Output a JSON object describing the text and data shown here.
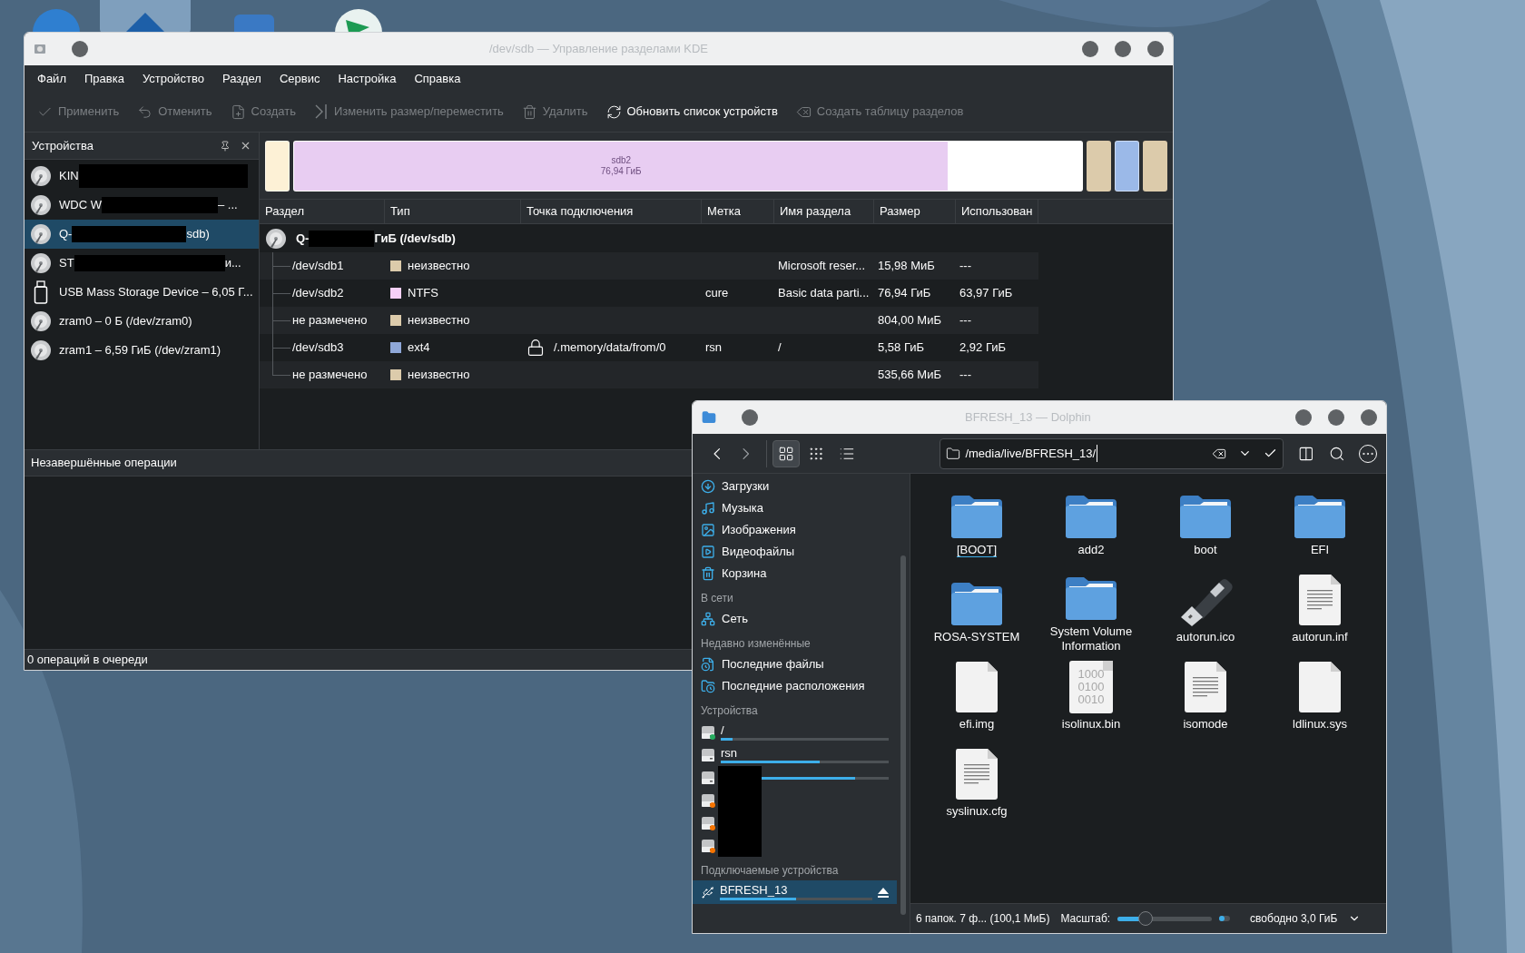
{
  "desktop_icons": [
    {
      "kind": "globe",
      "selected": false
    },
    {
      "kind": "home",
      "selected": true
    },
    {
      "kind": "window",
      "selected": false
    },
    {
      "kind": "arrow",
      "selected": false
    }
  ],
  "partition_manager": {
    "window_title": "/dev/sdb — Управление разделами KDE",
    "menu": [
      "Файл",
      "Правка",
      "Устройство",
      "Раздел",
      "Сервис",
      "Настройка",
      "Справка"
    ],
    "toolbar": [
      {
        "kind": "apply",
        "label": "Применить",
        "disabled": true
      },
      {
        "kind": "undo",
        "label": "Отменить",
        "disabled": true
      },
      {
        "kind": "create",
        "label": "Создать",
        "disabled": true
      },
      {
        "kind": "resize",
        "label": "Изменить размер/переместить",
        "disabled": true
      },
      {
        "kind": "delete",
        "label": "Удалить",
        "disabled": true
      },
      {
        "kind": "refresh",
        "label": "Обновить список устройств",
        "disabled": false
      },
      {
        "kind": "table",
        "label": "Создать таблицу разделов",
        "disabled": true
      }
    ],
    "devices_panel": {
      "title": "Устройства",
      "items": [
        {
          "kind": "disk",
          "text": "KIN",
          "redacted": true,
          "selected": false
        },
        {
          "kind": "disk",
          "text": "WDC W",
          "redacted": true,
          "text_after": "– ...",
          "selected": false
        },
        {
          "kind": "disk",
          "text": "Q-",
          "redacted": true,
          "text_after": "sdb)",
          "selected": true
        },
        {
          "kind": "disk",
          "text": "ST",
          "redacted": true,
          "text_after": "и...",
          "selected": false
        },
        {
          "kind": "usb",
          "text": "USB Mass Storage Device – 6,05 Г...",
          "redacted": false,
          "selected": false
        },
        {
          "kind": "disk",
          "text": "zram0 – 0 Б (/dev/zram0)",
          "redacted": false,
          "selected": false
        },
        {
          "kind": "disk",
          "text": "zram1 – 6,59 ГиБ (/dev/zram1)",
          "redacted": false,
          "selected": false
        }
      ]
    },
    "partition_bar": [
      {
        "kind": "partition",
        "color": "#fdf1d6"
      },
      {
        "kind": "partition",
        "color": "#e8cdf2",
        "level": 0.83,
        "name": "sdb2",
        "size": "76,94 ГиБ"
      },
      {
        "kind": "unallocated",
        "color": "#dccbab"
      },
      {
        "kind": "partition",
        "color": "#9bb9e8"
      },
      {
        "kind": "unallocated",
        "color": "#dccbab"
      }
    ],
    "table": {
      "columns": [
        "Раздел",
        "Тип",
        "Точка подключения",
        "Метка",
        "Имя раздела",
        "Размер",
        "Использован"
      ],
      "device": {
        "text": "Q-",
        "redacted": true,
        "text_after": "ГиБ (/dev/sdb)"
      },
      "rows": [
        {
          "partition": "/dev/sdb1",
          "type": "неизвестно",
          "color": "#dccbab",
          "locked": false,
          "name": "Microsoft reser...",
          "size": "15,98 МиБ",
          "used": "---"
        },
        {
          "partition": "/dev/sdb2",
          "type": "NTFS",
          "color": "#f5d0f7",
          "locked": false,
          "label": "cure",
          "name": "Basic data parti...",
          "size": "76,94 ГиБ",
          "used": "63,97 ГиБ"
        },
        {
          "partition": "не размечено",
          "type": "неизвестно",
          "color": "#dccbab",
          "locked": false,
          "size": "804,00 МиБ",
          "used": "---"
        },
        {
          "partition": "/dev/sdb3",
          "type": "ext4",
          "color": "#8fa8d8",
          "locked": true,
          "mount": "/.memory/data/from/0",
          "label": "rsn",
          "name": "/",
          "size": "5,58 ГиБ",
          "used": "2,92 ГиБ"
        },
        {
          "partition": "не размечено",
          "type": "неизвестно",
          "color": "#dccbab",
          "locked": false,
          "size": "535,66 МиБ",
          "used": "---"
        }
      ]
    },
    "pending": {
      "title": "Незавершённые операции"
    },
    "status": "0 операций в очереди"
  },
  "dolphin": {
    "window_title": "BFRESH_13 — Dolphin",
    "view_modes": [
      {
        "kind": "icons",
        "selected": true
      },
      {
        "kind": "compact",
        "selected": false
      },
      {
        "kind": "details",
        "selected": false
      }
    ],
    "path": "/media/live/BFRESH_13/",
    "places": [
      {
        "kind": "downloads",
        "label": "Загрузки"
      },
      {
        "kind": "music",
        "label": "Музыка"
      },
      {
        "kind": "pictures",
        "label": "Изображения"
      },
      {
        "kind": "videos",
        "label": "Видеофайлы"
      },
      {
        "kind": "trash",
        "label": "Корзина"
      }
    ],
    "network_heading": "В сети",
    "network": [
      {
        "kind": "network",
        "label": "Сеть"
      }
    ],
    "recent_heading": "Недавно изменённые",
    "recent": [
      {
        "kind": "recent-files",
        "label": "Последние файлы"
      },
      {
        "kind": "recent-folders",
        "label": "Последние расположения"
      }
    ],
    "devices_heading": "Устройства",
    "devices": [
      {
        "label": "/",
        "level": 0.07,
        "kind": "mounted",
        "redacted": false
      },
      {
        "label": "rsn",
        "level": 0.59,
        "kind": "plain",
        "redacted": false
      },
      {
        "level": 0.8,
        "kind": "plain",
        "redacted": true
      },
      {
        "kind": "warning",
        "redacted": true
      },
      {
        "kind": "warning",
        "redacted": true
      },
      {
        "kind": "warning",
        "redacted": true
      }
    ],
    "removable_heading": "Подключаемые устройства",
    "removable": [
      {
        "label": "BFRESH_13",
        "level": 0.5,
        "selected": true
      }
    ],
    "files": [
      {
        "kind": "folder",
        "name": "[BOOT]",
        "current": true
      },
      {
        "kind": "folder",
        "name": "add2",
        "current": false
      },
      {
        "kind": "folder",
        "name": "boot",
        "current": false
      },
      {
        "kind": "folder",
        "name": "EFI",
        "current": false
      },
      {
        "kind": "folder",
        "name": "ROSA-SYSTEM",
        "current": false
      },
      {
        "kind": "folder",
        "name": "System Volume Information",
        "current": false
      },
      {
        "kind": "usb",
        "name": "autorun.ico",
        "current": false
      },
      {
        "kind": "text",
        "name": "autorun.inf",
        "current": false
      },
      {
        "kind": "blank",
        "name": "efi.img",
        "current": false
      },
      {
        "kind": "binary",
        "name": "isolinux.bin",
        "current": false,
        "digits": [
          "1000",
          "0100",
          "0010"
        ]
      },
      {
        "kind": "text",
        "name": "isomode",
        "current": false
      },
      {
        "kind": "blank",
        "name": "ldlinux.sys",
        "current": false
      },
      {
        "kind": "text",
        "name": "syslinux.cfg",
        "current": false
      }
    ],
    "status": {
      "summary": "6 папок. 7 ф... (100,1 МиБ)",
      "zoom_label": "Масштаб:",
      "zoom": {
        "level": 0.3
      },
      "free": "свободно 3,0 ГиБ"
    }
  }
}
